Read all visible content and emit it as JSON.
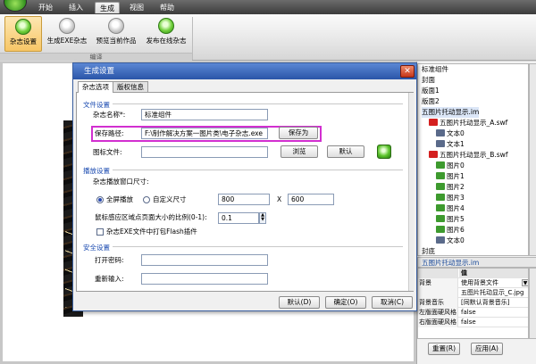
{
  "menu": {
    "tabs": [
      "开始",
      "插入",
      "生成",
      "视图",
      "帮助"
    ],
    "active_index": 2
  },
  "ribbon": {
    "buttons": [
      "杂志设置",
      "生成EXE杂志",
      "预览当前作品",
      "发布在线杂志"
    ],
    "group_label": "编译"
  },
  "tree": {
    "items": [
      {
        "label": "标准组件",
        "type": "none"
      },
      {
        "label": "封面",
        "type": "none"
      },
      {
        "label": "版面1",
        "type": "none"
      },
      {
        "label": "版面2",
        "type": "none"
      },
      {
        "label": "五图片托动显示.im",
        "type": "none"
      },
      {
        "label": "五图片托动显示_A.swf",
        "type": "swf"
      },
      {
        "label": "文本0",
        "type": "txt"
      },
      {
        "label": "文本1",
        "type": "txt"
      },
      {
        "label": "五图片托动显示_B.swf",
        "type": "swf"
      },
      {
        "label": "图片0",
        "type": "pic"
      },
      {
        "label": "图片1",
        "type": "pic"
      },
      {
        "label": "图片2",
        "type": "pic"
      },
      {
        "label": "图片3",
        "type": "pic"
      },
      {
        "label": "图片4",
        "type": "pic"
      },
      {
        "label": "图片5",
        "type": "pic"
      },
      {
        "label": "图片6",
        "type": "pic"
      },
      {
        "label": "文本0",
        "type": "txt"
      },
      {
        "label": "封底",
        "type": "none"
      }
    ]
  },
  "props": {
    "title": "五图片托动显示.im",
    "header": {
      "key": "",
      "value": "值"
    },
    "rows": [
      {
        "key": "背景",
        "value": "使用背景文件",
        "dropdown": true
      },
      {
        "key": "",
        "value": "五图片托动显示_C.jpg",
        "dropdown": false
      },
      {
        "key": "背景音乐",
        "value": "[同默认背景音乐]",
        "dropdown": false
      },
      {
        "key": "左版面硬风格",
        "value": "false",
        "dropdown": false
      },
      {
        "key": "右版面硬风格",
        "value": "false",
        "dropdown": false
      }
    ],
    "reset_label": "重置(R)",
    "apply_label": "应用(A)"
  },
  "dialog": {
    "title": "生成设置",
    "close_glyph": "✕",
    "tabs": [
      "杂志选项",
      "版权信息"
    ],
    "file_section": {
      "title": "文件设置",
      "name_label": "杂志名称*:",
      "name_value": "标准组件",
      "path_label": "保存路径:",
      "path_value": "F:\\制作解决方案一图片类\\电子杂志.exe",
      "save_as_label": "保存为",
      "icon_label": "图标文件:",
      "icon_value": "",
      "browse_label": "浏览",
      "default_label": "默认"
    },
    "play_section": {
      "title": "播放设置",
      "window_size_label": "杂志播放窗口尺寸:",
      "fullscreen_label": "全屏播放",
      "custom_label": "自定义尺寸",
      "width_value": "800",
      "times": "X",
      "height_value": "600",
      "ratio_label": "鼠标感应区域点页面大小的比例(0-1):",
      "ratio_value": "0.1",
      "flash_label": "杂志EXE文件中打包Flash插件"
    },
    "security_section": {
      "title": "安全设置",
      "password_label": "打开密码:",
      "password_value": "",
      "repeat_label": "重新输入:",
      "repeat_value": ""
    },
    "footer": {
      "default_label": "默认(D)",
      "ok_label": "确定(O)",
      "cancel_label": "取消(C)"
    }
  }
}
